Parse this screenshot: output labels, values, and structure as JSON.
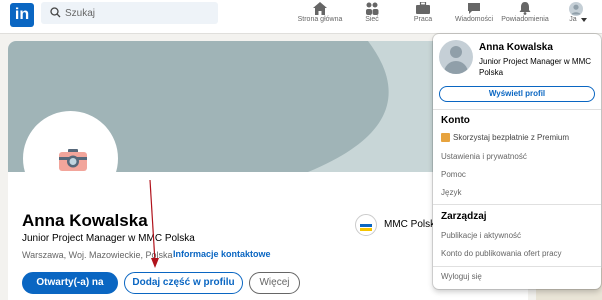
{
  "nav": {
    "logo": "in",
    "search_placeholder": "Szukaj",
    "items": [
      {
        "label": "Strona główna",
        "icon": "home-icon"
      },
      {
        "label": "Sieć",
        "icon": "network-icon"
      },
      {
        "label": "Praca",
        "icon": "briefcase-icon"
      },
      {
        "label": "Wiadomości",
        "icon": "messaging-icon"
      },
      {
        "label": "Powiadomienia",
        "icon": "bell-icon"
      },
      {
        "label": "Ja",
        "icon": "avatar-icon"
      }
    ]
  },
  "profile": {
    "name": "Anna Kowalska",
    "headline": "Junior Project Manager w MMC Polska",
    "location": "Warszawa, Woj. Mazowieckie, Polska",
    "contact_link": "Informacje kontaktowe",
    "company": "MMC Polska",
    "buttons": {
      "open_to": "Otwarty(-a) na",
      "add_section": "Dodaj część w profilu",
      "more": "Więcej"
    }
  },
  "dropdown": {
    "name": "Anna Kowalska",
    "role": "Junior Project Manager w MMC Polska",
    "view_profile": "Wyświetl profil",
    "account_header": "Konto",
    "premium": "Skorzystaj bezpłatnie z Premium",
    "account_items": [
      "Ustawienia i prywatność",
      "Pomoc",
      "Język"
    ],
    "manage_header": "Zarządzaj",
    "manage_items": [
      "Publikacje i aktywność",
      "Konto do publikowania ofert pracy"
    ],
    "signout": "Wyloguj się"
  },
  "colors": {
    "brand": "#0a66c2",
    "banner": "#a0b4b7",
    "premium": "#e7a33e",
    "annotation_arrow": "#b0121b"
  }
}
